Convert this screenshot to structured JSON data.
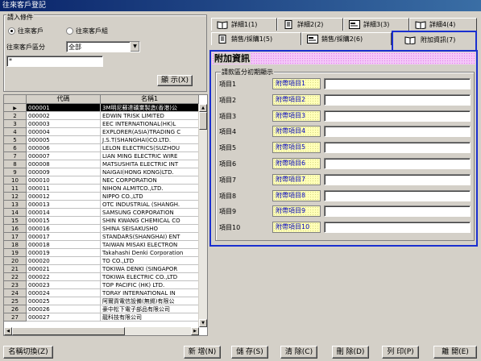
{
  "window": {
    "title": "往來客戶登記"
  },
  "filter": {
    "group_title": "請入條件",
    "radio_customer": "往來客戶",
    "radio_group": "往來客戶組",
    "category_label": "往來客戶區分",
    "category_value": "全部",
    "search_value": "*",
    "display_button": "顯 示(X)"
  },
  "grid": {
    "col_code": "代碼",
    "col_name": "名稱1",
    "rows": [
      {
        "n": "",
        "code": "000001",
        "name": "3M明尼蘇達礦業製造(香港)公"
      },
      {
        "n": "2",
        "code": "000002",
        "name": "EDWIN TRISK LIMITED"
      },
      {
        "n": "3",
        "code": "000003",
        "name": "EEC INTERNATIONAL(HK)L"
      },
      {
        "n": "4",
        "code": "000004",
        "name": "EXPLORER(ASIA)TRADING C"
      },
      {
        "n": "5",
        "code": "000005",
        "name": "J.S.T(SHANGHAI)CO.LTD."
      },
      {
        "n": "6",
        "code": "000006",
        "name": "LELON ELECTRICS(SUZHOU"
      },
      {
        "n": "7",
        "code": "000007",
        "name": "LIAN MING ELECTRIC WIRE"
      },
      {
        "n": "8",
        "code": "000008",
        "name": "MATSUSHITA ELECTRIC INT"
      },
      {
        "n": "9",
        "code": "000009",
        "name": "NAIGAI(HONG KONG)LTD."
      },
      {
        "n": "10",
        "code": "000010",
        "name": "NEC CORPORATION"
      },
      {
        "n": "11",
        "code": "000011",
        "name": "NIHON ALMITCO.,LTD."
      },
      {
        "n": "12",
        "code": "000012",
        "name": "NIPPO CO.,LTD"
      },
      {
        "n": "13",
        "code": "000013",
        "name": "OTC INDUSTRIAL (SHANGH."
      },
      {
        "n": "14",
        "code": "000014",
        "name": "SAMSUNG CORPORATION"
      },
      {
        "n": "15",
        "code": "000015",
        "name": "SHIN KWANG CHEMICAL CO"
      },
      {
        "n": "16",
        "code": "000016",
        "name": "SHINA SEISAKUSHO"
      },
      {
        "n": "17",
        "code": "000017",
        "name": "STANDARS(SHANGHAI) ENT"
      },
      {
        "n": "18",
        "code": "000018",
        "name": "TAIWAN MISAKI ELECTRON"
      },
      {
        "n": "19",
        "code": "000019",
        "name": "Takahashi Denki Corporation"
      },
      {
        "n": "20",
        "code": "000020",
        "name": "TO CO.,LTD"
      },
      {
        "n": "21",
        "code": "000021",
        "name": "TOKIWA DENKI (SINGAPOR"
      },
      {
        "n": "22",
        "code": "000022",
        "name": "TOKIWA ELECTRIC CO.,LTD"
      },
      {
        "n": "23",
        "code": "000023",
        "name": "TOP PACIFIC (HK) LTD."
      },
      {
        "n": "24",
        "code": "000024",
        "name": "TORAY INTERNATIONAL IN"
      },
      {
        "n": "25",
        "code": "000025",
        "name": "阿爾貢電信設備(無錫)有限公"
      },
      {
        "n": "26",
        "code": "000026",
        "name": "豪中松下電子部品有限公司"
      },
      {
        "n": "27",
        "code": "000027",
        "name": "龍科技有限公司"
      }
    ]
  },
  "tabs": {
    "row1": [
      "詳細1(1)",
      "詳細2(2)",
      "詳細3(3)",
      "詳細4(4)"
    ],
    "row2": [
      "銷售/採購1(5)",
      "銷售/採購2(6)",
      "附加資訊(7)"
    ]
  },
  "panel": {
    "title": "附加資訊",
    "group_title": "請款區分初期顯示",
    "items": [
      {
        "label": "項目1",
        "tag": "附帶項目1",
        "value": ""
      },
      {
        "label": "項目2",
        "tag": "附帶項目2",
        "value": ""
      },
      {
        "label": "項目3",
        "tag": "附帶項目3",
        "value": ""
      },
      {
        "label": "項目4",
        "tag": "附帶項目4",
        "value": ""
      },
      {
        "label": "項目5",
        "tag": "附帶項目5",
        "value": ""
      },
      {
        "label": "項目6",
        "tag": "附帶項目6",
        "value": ""
      },
      {
        "label": "項目7",
        "tag": "附帶項目7",
        "value": ""
      },
      {
        "label": "項目8",
        "tag": "附帶項目8",
        "value": ""
      },
      {
        "label": "項目9",
        "tag": "附帶項目9",
        "value": ""
      },
      {
        "label": "項目10",
        "tag": "附帶項目10",
        "value": ""
      }
    ]
  },
  "footer": {
    "name_switch": "名稱切換(Z)",
    "new": "新 增(N)",
    "save": "儲 存(S)",
    "clear": "清 除(C)",
    "delete": "刪 除(D)",
    "print": "列 印(P)",
    "close": "離 開(E)"
  },
  "colors": {
    "accent": "#1a2fd0",
    "title_bar": "#0a246a",
    "tag_text": "#0000c0",
    "banner": "#f4c8f8",
    "tag_bg": "#ffffb8"
  }
}
